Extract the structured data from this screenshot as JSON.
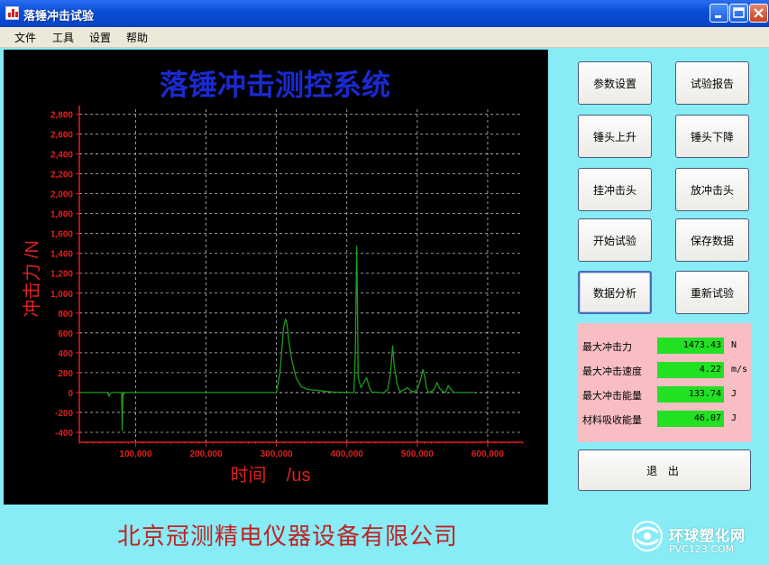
{
  "window": {
    "title": "落锤冲击试验"
  },
  "menu": [
    "文件",
    "工具",
    "设置",
    "帮助"
  ],
  "chart": {
    "heading": "落锤冲击测控系统"
  },
  "buttons": {
    "params": "参数设置",
    "report": "试验报告",
    "hammer_up": "锤头上升",
    "hammer_down": "锤头下降",
    "hang_head": "挂冲击头",
    "release_head": "放冲击头",
    "start_test": "开始试验",
    "save_data": "保存数据",
    "analyze": "数据分析",
    "retest": "重新试验",
    "exit": "退  出"
  },
  "results": [
    {
      "label": "最大冲击力",
      "value": "1473.43",
      "unit": "N"
    },
    {
      "label": "最大冲击速度",
      "value": "4.22",
      "unit": "m/s"
    },
    {
      "label": "最大冲击能量",
      "value": "133.74",
      "unit": "J"
    },
    {
      "label": "材料吸收能量",
      "value": "46.07",
      "unit": "J"
    }
  ],
  "footer": {
    "company": "北京冠测精电仪器设备有限公司"
  },
  "watermark": {
    "name_cn": "环球塑化网",
    "site": "PVC123.COM"
  },
  "colors": {
    "axis": "#e02020",
    "line": "#1e9a1e",
    "grid": "#bdbdbd",
    "heading": "#1a2ad0"
  },
  "chart_data": {
    "type": "line",
    "xlabel": "时间    /us",
    "ylabel": "冲击力 /N",
    "xlim": [
      20000,
      650000
    ],
    "ylim": [
      -500,
      2850
    ],
    "x_ticks": [
      100000,
      200000,
      300000,
      400000,
      500000,
      600000
    ],
    "x_tick_labels": [
      "100,000",
      "200,000",
      "300,000",
      "400,000",
      "500,000",
      "600,000"
    ],
    "y_ticks": [
      2800,
      2600,
      2400,
      2200,
      2000,
      1800,
      1600,
      1400,
      1200,
      1000,
      800,
      600,
      400,
      200,
      0,
      -200,
      -400
    ],
    "y_tick_labels": [
      "2,800",
      "2,600",
      "2,400",
      "2,200",
      "2,000",
      "1,800",
      "1,600",
      "1,400",
      "1,200",
      "1,000",
      "800",
      "600",
      "400",
      "200",
      "0",
      "-200",
      "-400"
    ],
    "grid": true,
    "series": [
      {
        "x": [
          20000,
          60000,
          62000,
          64000,
          66000,
          80000,
          81000,
          82000,
          83000,
          84000,
          100000,
          200000,
          300000,
          305000,
          310000,
          313000,
          315000,
          318000,
          322000,
          328000,
          335000,
          345000,
          360000,
          372000,
          380000,
          405000,
          410000,
          412000,
          414000,
          415000,
          416000,
          418000,
          420000,
          424000,
          428000,
          432000,
          436000,
          440000,
          446000,
          452000,
          458000,
          462000,
          465000,
          467000,
          469000,
          471000,
          473000,
          476000,
          478000,
          482000,
          486000,
          490000,
          495000,
          500000,
          505000,
          508000,
          511000,
          513000,
          516000,
          520000,
          524000,
          528000,
          532000,
          536000,
          540000,
          544000,
          548000,
          552000,
          560000,
          580000
        ],
        "y": [
          0,
          0,
          -40,
          -10,
          0,
          0,
          -380,
          0,
          -20,
          0,
          0,
          0,
          0,
          200,
          650,
          740,
          680,
          500,
          320,
          150,
          60,
          30,
          20,
          10,
          5,
          0,
          0,
          400,
          1473,
          900,
          150,
          100,
          50,
          100,
          150,
          50,
          0,
          5,
          0,
          -5,
          30,
          200,
          470,
          280,
          200,
          100,
          50,
          0,
          20,
          30,
          50,
          20,
          5,
          30,
          140,
          230,
          150,
          50,
          0,
          10,
          30,
          100,
          40,
          10,
          0,
          70,
          30,
          0,
          0,
          0
        ]
      }
    ]
  }
}
